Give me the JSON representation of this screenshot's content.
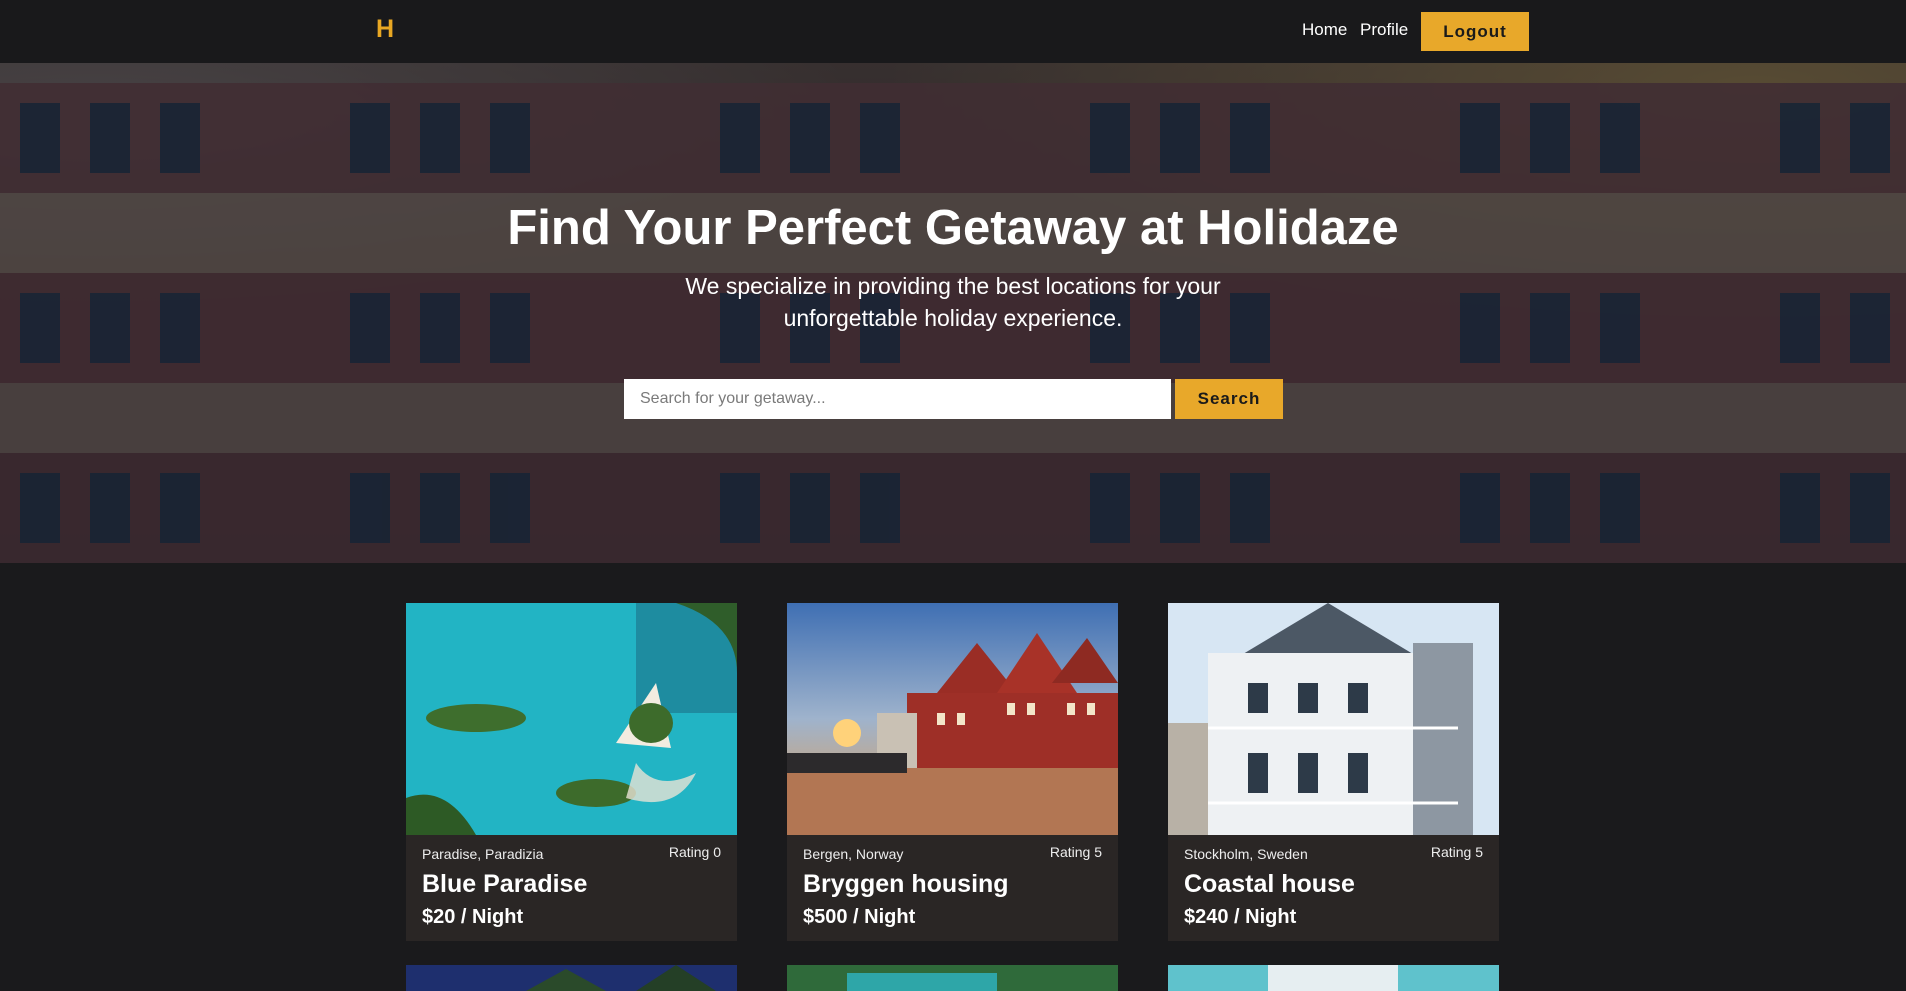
{
  "nav": {
    "logo": "H",
    "links": [
      {
        "label": "Home"
      },
      {
        "label": "Profile"
      }
    ],
    "logout_label": "Logout"
  },
  "hero": {
    "title": "Find Your Perfect Getaway at Holidaze",
    "subtitle": "We specialize in providing the best locations for your unforgettable holiday experience.",
    "search": {
      "placeholder": "Search for your getaway...",
      "value": "",
      "button_label": "Search"
    }
  },
  "venues": [
    {
      "location": "Paradise, Paradizia",
      "rating": "Rating 0",
      "name": "Blue Paradise",
      "price": "$20 / Night"
    },
    {
      "location": "Bergen, Norway",
      "rating": "Rating 5",
      "name": "Bryggen housing",
      "price": "$500 / Night"
    },
    {
      "location": "Stockholm, Sweden",
      "rating": "Rating 5",
      "name": "Coastal house",
      "price": "$240 / Night"
    }
  ],
  "colors": {
    "accent": "#e8a82a",
    "background": "#1a1a1c",
    "nav": "#19191b",
    "card": "#2a2625"
  }
}
